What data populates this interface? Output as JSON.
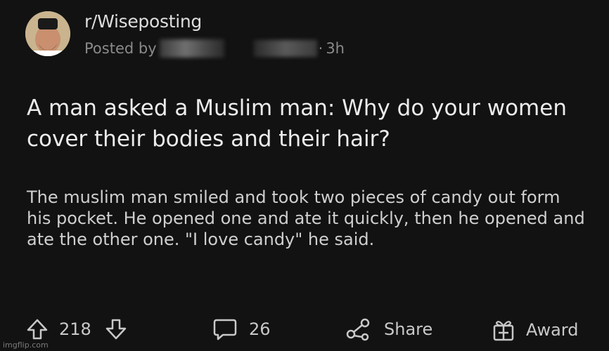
{
  "post": {
    "subreddit": "r/Wiseposting",
    "posted_by_label": "Posted by",
    "time_ago": "3h",
    "title": "A man asked a Muslim man: Why do your women cover their bodies and their hair?",
    "body": "The muslim man smiled and took two pieces of candy out form his pocket. He opened one and ate it quickly, then he opened and ate the other one. \"I love candy\" he said."
  },
  "actions": {
    "upvotes": "218",
    "comments": "26",
    "share_label": "Share",
    "award_label": "Award"
  },
  "icons": [
    "upvote-icon",
    "downvote-icon",
    "comment-icon",
    "share-icon",
    "award-icon"
  ],
  "watermark": "imgflip.com",
  "colors": {
    "background": "#121212",
    "text": "#e6e6e6",
    "muted": "#8a8a8a"
  }
}
